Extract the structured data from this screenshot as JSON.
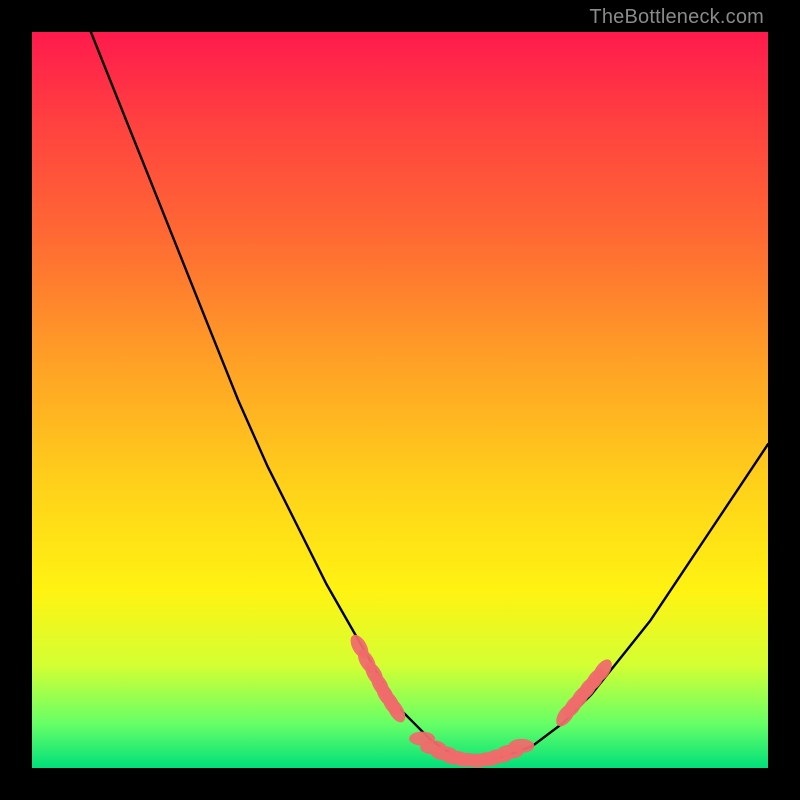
{
  "watermark": "TheBottleneck.com",
  "chart_data": {
    "type": "line",
    "title": "",
    "xlabel": "",
    "ylabel": "",
    "xlim": [
      0,
      100
    ],
    "ylim": [
      0,
      100
    ],
    "legend": false,
    "grid": false,
    "background": "red-yellow-green vertical gradient",
    "series": [
      {
        "name": "bottleneck-curve",
        "color": "#000000",
        "x": [
          8,
          12,
          16,
          20,
          24,
          28,
          32,
          36,
          40,
          44,
          48,
          50,
          52,
          54,
          56,
          58,
          60,
          62,
          64,
          68,
          72,
          76,
          80,
          84,
          88,
          92,
          96,
          100
        ],
        "values": [
          100,
          90,
          80,
          70,
          60,
          50,
          41,
          33,
          25,
          18,
          11,
          8,
          6,
          4,
          2.5,
          1.5,
          1,
          1,
          1.5,
          3,
          6,
          10,
          15,
          20,
          26,
          32,
          38,
          44
        ]
      }
    ],
    "markers": [
      {
        "name": "left-cluster",
        "color": "#ef6b6b",
        "shape": "lozenge",
        "points_x": [
          44.5,
          45.5,
          46.5,
          47.3,
          48.0,
          48.8,
          49.5
        ],
        "points_y": [
          16.5,
          14.5,
          12.8,
          11.3,
          10.0,
          8.8,
          7.8
        ]
      },
      {
        "name": "bottom-cluster",
        "color": "#ef6b6b",
        "shape": "lozenge",
        "points_x": [
          53.0,
          54.5,
          56.0,
          57.5,
          59.0,
          60.5,
          62.0,
          63.5,
          65.0,
          66.5
        ],
        "points_y": [
          4.0,
          2.8,
          2.0,
          1.4,
          1.1,
          1.0,
          1.2,
          1.6,
          2.2,
          3.0
        ]
      },
      {
        "name": "right-cluster",
        "color": "#ef6b6b",
        "shape": "lozenge",
        "points_x": [
          72.5,
          73.5,
          74.5,
          75.5,
          76.5,
          77.5
        ],
        "points_y": [
          7.2,
          8.4,
          9.6,
          10.8,
          12.0,
          13.2
        ]
      }
    ]
  }
}
